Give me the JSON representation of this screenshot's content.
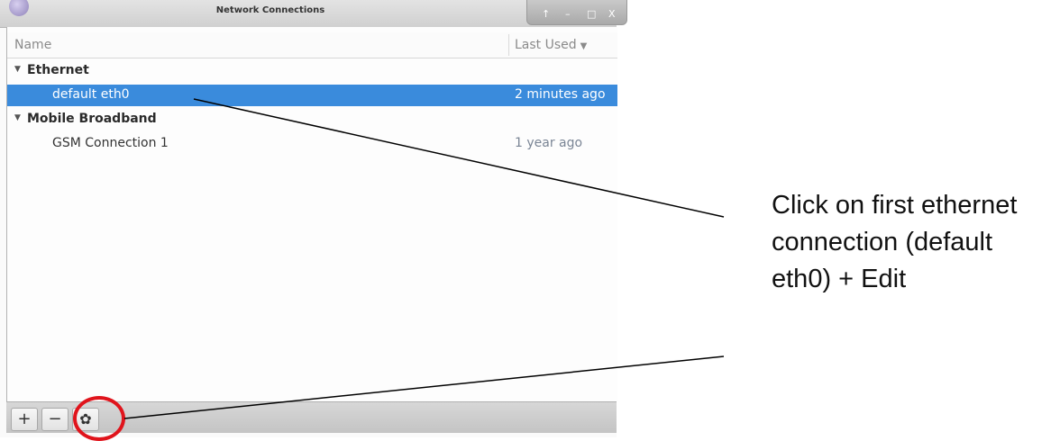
{
  "window": {
    "title": "Network Connections",
    "buttons": [
      "↑",
      "–",
      "□",
      "X"
    ]
  },
  "list": {
    "columns": {
      "name": "Name",
      "last_used": "Last Used"
    },
    "groups": [
      {
        "label": "Ethernet",
        "connections": [
          {
            "name": "default eth0",
            "last_used": "2 minutes ago",
            "selected": true
          }
        ]
      },
      {
        "label": "Mobile Broadband",
        "connections": [
          {
            "name": "GSM Connection 1",
            "last_used": "1 year ago",
            "selected": false
          }
        ]
      }
    ]
  },
  "toolbar": {
    "add_label": "+",
    "remove_label": "−",
    "settings_icon": "gear-icon"
  },
  "annotation": {
    "text": "Click on first ethernet connection (default eth0) + Edit",
    "line1": "Click on first ethernet",
    "line2": "connection (default",
    "line3": "eth0) + Edit"
  },
  "colors": {
    "selection": "#3a8bdc",
    "highlight_circle": "#e0141c"
  }
}
